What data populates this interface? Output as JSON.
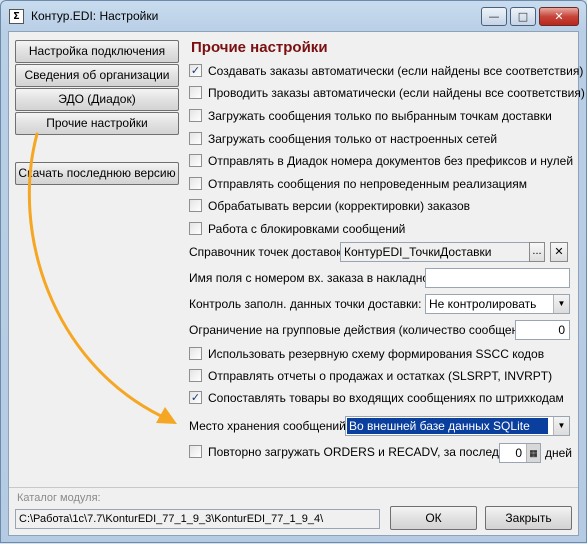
{
  "window": {
    "title": "Контур.EDI: Настройки",
    "icon_glyph": "Σ",
    "minimize_glyph": "—",
    "maximize_glyph": "□",
    "close_glyph": "✕"
  },
  "left_nav": {
    "items": [
      {
        "label": "Настройка подключения"
      },
      {
        "label": "Сведения об организации"
      },
      {
        "label": "ЭДО (Диадок)"
      },
      {
        "label": "Прочие настройки"
      }
    ],
    "download_label": "Скачать последнюю версию"
  },
  "section_title": "Прочие настройки",
  "checkboxes": [
    {
      "label": "Создавать заказы автоматически (если найдены все соответствия)",
      "checked": true
    },
    {
      "label": "Проводить заказы автоматически (если найдены все соответствия)",
      "checked": false
    },
    {
      "label": "Загружать сообщения только по выбранным точкам доставки",
      "checked": false
    },
    {
      "label": "Загружать сообщения только от настроенных сетей",
      "checked": false
    },
    {
      "label": "Отправлять в Диадок номера документов без префиксов и нулей",
      "checked": false
    },
    {
      "label": "Отправлять сообщения по непроведенным реализациям",
      "checked": false
    },
    {
      "label": "Обрабатывать версии (корректировки) заказов",
      "checked": false
    },
    {
      "label": "Работа с блокировками сообщений",
      "checked": false
    }
  ],
  "fields": {
    "delivery_ref_label": "Справочник точек доставок:",
    "delivery_ref_value": "КонтурEDI_ТочкиДоставки",
    "ellipsis_label": "...",
    "clear_label": "✕",
    "order_field_label": "Имя поля с номером вх. заказа в накладной:",
    "order_field_value": "",
    "fill_control_label": "Контроль заполн. данных точки доставки:",
    "fill_control_value": "Не контролировать",
    "group_limit_label": "Ограничение на групповые действия (количество сообщений):",
    "group_limit_value": "0"
  },
  "checkboxes_2": [
    {
      "label": "Использовать резервную схему формирования SSCC кодов",
      "checked": false
    },
    {
      "label": "Отправлять отчеты о продажах и остатках (SLSRPT, INVRPT)",
      "checked": false
    },
    {
      "label": "Сопоставлять товары во входящих сообщениях по штрихкодам",
      "checked": true
    }
  ],
  "storage": {
    "label": "Место хранения сообщений:",
    "value": "Во внешней базе данных SQLite"
  },
  "reload": {
    "label": "Повторно загружать ORDERS и RECADV, за последние",
    "checked": false,
    "days_value": "0",
    "days_label": "дней"
  },
  "footer": {
    "catalog_label": "Каталог модуля:",
    "catalog_path": "C:\\Работа\\1с\\7.7\\KonturEDI_77_1_9_3\\KonturEDI_77_1_9_4\\",
    "ok_label": "ОК",
    "close_label": "Закрыть"
  },
  "colors": {
    "accent_arrow": "#f5a623",
    "heading": "#7a1010",
    "selection": "#0a3f9e"
  }
}
